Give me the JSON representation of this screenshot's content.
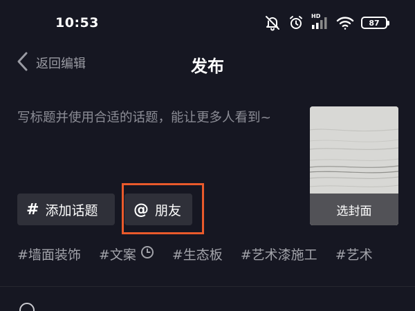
{
  "status_bar": {
    "time": "10:53",
    "network_label": "HD",
    "battery": "87",
    "icons": [
      "bell-off-icon",
      "alarm-icon",
      "signal-icon",
      "wifi-icon",
      "battery-icon"
    ]
  },
  "nav": {
    "back_label": "返回编辑",
    "title": "发布"
  },
  "caption": {
    "placeholder": "写标题并使用合适的话题，能让更多人看到~"
  },
  "cover": {
    "label": "选封面"
  },
  "chips": {
    "topic": {
      "glyph": "#",
      "label": "添加话题"
    },
    "friend": {
      "glyph": "@",
      "label": "朋友"
    }
  },
  "tags": [
    "#墙面装饰",
    "#文案",
    "#生态板",
    "#艺术漆施工",
    "#艺术"
  ],
  "colors": {
    "background": "#161722",
    "chip": "#2f3039",
    "highlight": "#ea5a2b",
    "muted_text": "#8b8c95"
  }
}
